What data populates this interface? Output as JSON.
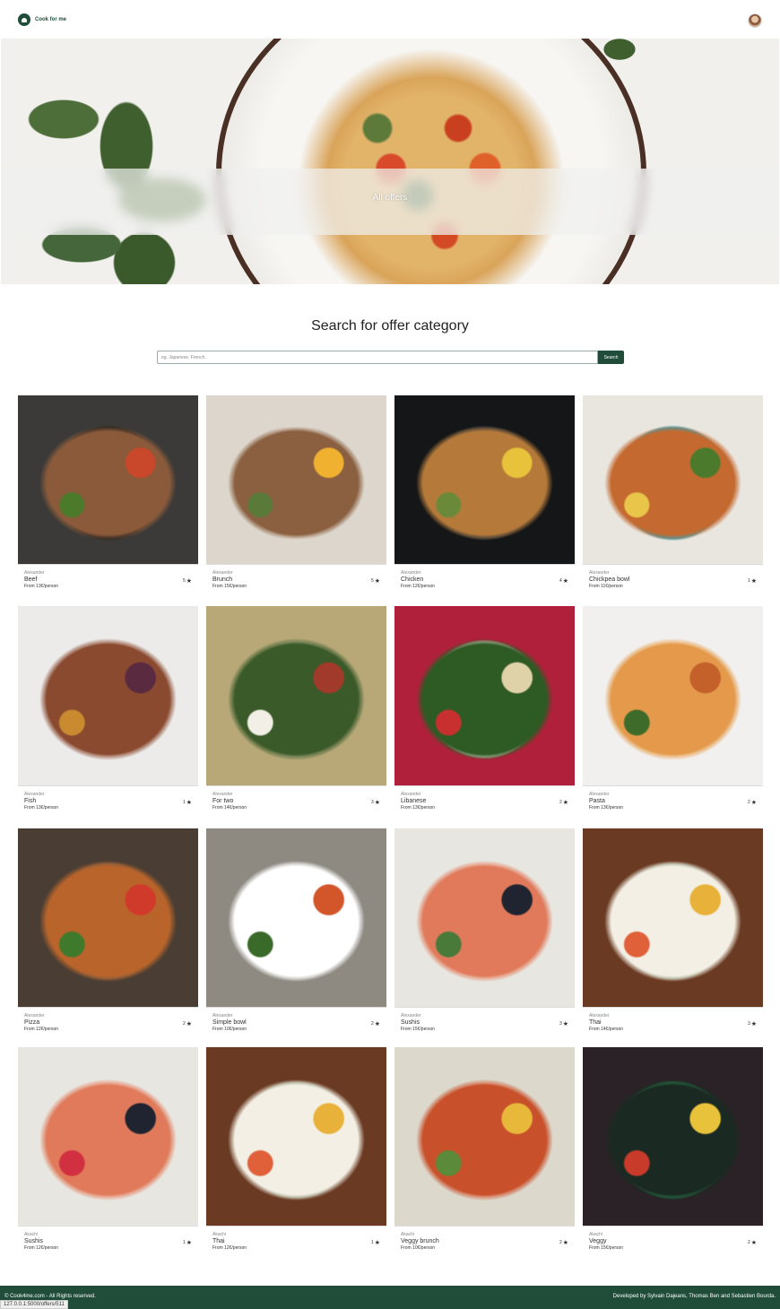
{
  "navbar": {
    "brand_name": "Cook for me"
  },
  "hero": {
    "title": "All offers"
  },
  "search": {
    "title": "Search for offer category",
    "placeholder": "eg. Japanese, French..",
    "button_label": "Search"
  },
  "offers": [
    {
      "author": "Alexander",
      "name": "Beef",
      "price": "From 13€/person",
      "rating": "5",
      "colors": [
        "#3b3a38",
        "#1c1c1c",
        "#8a5a3a",
        "#c9472a",
        "#4a7a2a"
      ]
    },
    {
      "author": "Alexander",
      "name": "Brunch",
      "price": "From 15€/person",
      "rating": "5",
      "colors": [
        "#dcd6cc",
        "#f3efe7",
        "#8a6040",
        "#f0b030",
        "#5a7a3a"
      ]
    },
    {
      "author": "Alexander",
      "name": "Chicken",
      "price": "From 12€/person",
      "rating": "4",
      "colors": [
        "#141618",
        "#1e2a36",
        "#b57a3a",
        "#e8c23a",
        "#6a8a3a"
      ]
    },
    {
      "author": "Alexander",
      "name": "Chickpea bowl",
      "price": "From 11€/person",
      "rating": "1",
      "colors": [
        "#e9e6e0",
        "#3aa0b0",
        "#c46a30",
        "#4c7a2c",
        "#e9c64a"
      ]
    },
    {
      "author": "Alexander",
      "name": "Fish",
      "price": "From 13€/person",
      "rating": "1",
      "colors": [
        "#ecebea",
        "#ffffff",
        "#8a4a30",
        "#5a2a40",
        "#c98a30"
      ]
    },
    {
      "author": "Alexander",
      "name": "For two",
      "price": "From 14€/person",
      "rating": "3",
      "colors": [
        "#b8a878",
        "#d2c39a",
        "#3a5a2a",
        "#a13a2a",
        "#f2efe6"
      ]
    },
    {
      "author": "Alexander",
      "name": "Libanese",
      "price": "From 13€/person",
      "rating": "2",
      "colors": [
        "#b1203a",
        "#f3eee4",
        "#2e5a24",
        "#e0d2a8",
        "#c83030"
      ]
    },
    {
      "author": "Alexander",
      "name": "Pasta",
      "price": "From 13€/person",
      "rating": "2",
      "colors": [
        "#f1f0ee",
        "#ffffff",
        "#e49a4a",
        "#c4602a",
        "#3e6a2a"
      ]
    },
    {
      "author": "Alexander",
      "name": "Pizza",
      "price": "From 12€/person",
      "rating": "2",
      "colors": [
        "#4a3e34",
        "#6a5a4a",
        "#b8642a",
        "#d03a2a",
        "#3f7a2c"
      ]
    },
    {
      "author": "Alexander",
      "name": "Simple bowl",
      "price": "From 10€/person",
      "rating": "2",
      "colors": [
        "#8e8a82",
        "#a8a49a",
        "#ffffff",
        "#d2562a",
        "#3a6a2a"
      ]
    },
    {
      "author": "Alexander",
      "name": "Sushis",
      "price": "From 15€/person",
      "rating": "3",
      "colors": [
        "#e8e6e0",
        "#f6f4ef",
        "#e07a5a",
        "#202430",
        "#4a7a3a"
      ]
    },
    {
      "author": "Alexander",
      "name": "Thai",
      "price": "From 14€/person",
      "rating": "3",
      "colors": [
        "#6a3a22",
        "#7f8a6a",
        "#f3efe4",
        "#e8b23a",
        "#e0603a"
      ]
    },
    {
      "author": "Akachi",
      "name": "Sushis",
      "price": "From 12€/person",
      "rating": "1",
      "colors": [
        "#e8e6e0",
        "#f6f4ef",
        "#e07a5a",
        "#202430",
        "#d03040"
      ]
    },
    {
      "author": "Akachi",
      "name": "Thai",
      "price": "From 12€/person",
      "rating": "1",
      "colors": [
        "#6a3a22",
        "#7f8a6a",
        "#f3efe4",
        "#e8b23a",
        "#e0603a"
      ]
    },
    {
      "author": "Akachi",
      "name": "Veggy brunch",
      "price": "From 10€/person",
      "rating": "2",
      "colors": [
        "#dcd8cc",
        "#f2efe6",
        "#c8502a",
        "#e8b83a",
        "#5a8a3a"
      ]
    },
    {
      "author": "Akachi",
      "name": "Veggy",
      "price": "From 15€/person",
      "rating": "2",
      "colors": [
        "#2a2226",
        "#2a9a5a",
        "#1a2a22",
        "#e8c23a",
        "#c83a2a"
      ]
    }
  ],
  "footer": {
    "copyright": "© Cook4me.com - All Rights reserved.",
    "credits": "Developed by Sylvain Dajeans, Thomas Ben and Sebastien Bourda."
  },
  "status_bar": {
    "url": "127.0.0.1:5000/offers/511"
  }
}
